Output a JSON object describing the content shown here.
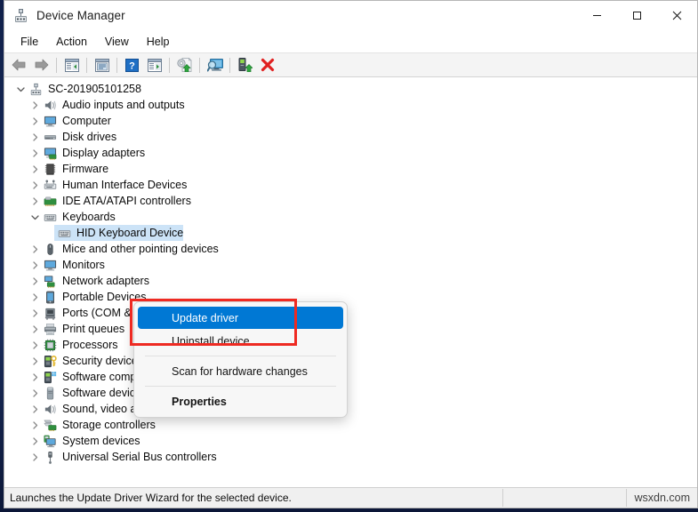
{
  "window": {
    "title": "Device Manager",
    "icon": "device-manager-icon",
    "controls": {
      "minimize": "minimize-icon",
      "maximize": "maximize-icon",
      "close": "close-icon"
    }
  },
  "menubar": {
    "items": [
      {
        "label": "File"
      },
      {
        "label": "Action"
      },
      {
        "label": "View"
      },
      {
        "label": "Help"
      }
    ]
  },
  "toolbar": {
    "buttons": [
      {
        "name": "back-icon",
        "title": "Back"
      },
      {
        "name": "forward-icon",
        "title": "Forward"
      },
      {
        "name": "show-hide-console-tree-icon",
        "title": "Show/Hide Console Tree"
      },
      {
        "name": "properties-icon",
        "title": "Properties"
      },
      {
        "name": "help-icon",
        "title": "Help"
      },
      {
        "name": "view-details-icon",
        "title": "View"
      },
      {
        "name": "update-driver-icon",
        "title": "Update driver"
      },
      {
        "name": "scan-for-hardware-changes-icon",
        "title": "Scan for hardware changes"
      },
      {
        "name": "enable-device-icon",
        "title": "Enable device"
      },
      {
        "name": "uninstall-device-icon",
        "title": "Uninstall device"
      }
    ]
  },
  "tree": {
    "root": {
      "label": "SC-201905101258",
      "icon": "computer-root-icon",
      "expanded": true
    },
    "items": [
      {
        "label": "Audio inputs and outputs",
        "icon": "speaker-icon",
        "indent": 1,
        "expandable": true,
        "expanded": false
      },
      {
        "label": "Computer",
        "icon": "monitor-icon",
        "indent": 1,
        "expandable": true,
        "expanded": false
      },
      {
        "label": "Disk drives",
        "icon": "disk-drive-icon",
        "indent": 1,
        "expandable": true,
        "expanded": false
      },
      {
        "label": "Display adapters",
        "icon": "display-adapter-icon",
        "indent": 1,
        "expandable": true,
        "expanded": false
      },
      {
        "label": "Firmware",
        "icon": "firmware-icon",
        "indent": 1,
        "expandable": true,
        "expanded": false
      },
      {
        "label": "Human Interface Devices",
        "icon": "hid-icon",
        "indent": 1,
        "expandable": true,
        "expanded": false
      },
      {
        "label": "IDE ATA/ATAPI controllers",
        "icon": "ide-controller-icon",
        "indent": 1,
        "expandable": true,
        "expanded": false
      },
      {
        "label": "Keyboards",
        "icon": "keyboard-icon",
        "indent": 1,
        "expandable": true,
        "expanded": true
      },
      {
        "label": "HID Keyboard Device",
        "icon": "keyboard-icon",
        "indent": 2,
        "expandable": false,
        "expanded": false,
        "selected": true
      },
      {
        "label": "Mice and other pointing devices",
        "icon": "mouse-icon",
        "indent": 1,
        "expandable": true,
        "expanded": false
      },
      {
        "label": "Monitors",
        "icon": "monitor-icon",
        "indent": 1,
        "expandable": true,
        "expanded": false
      },
      {
        "label": "Network adapters",
        "icon": "network-adapter-icon",
        "indent": 1,
        "expandable": true,
        "expanded": false
      },
      {
        "label": "Portable Devices",
        "icon": "portable-device-icon",
        "indent": 1,
        "expandable": true,
        "expanded": false
      },
      {
        "label": "Ports (COM & LPT)",
        "icon": "ports-icon",
        "indent": 1,
        "expandable": true,
        "expanded": false
      },
      {
        "label": "Print queues",
        "icon": "printer-icon",
        "indent": 1,
        "expandable": true,
        "expanded": false
      },
      {
        "label": "Processors",
        "icon": "processor-icon",
        "indent": 1,
        "expandable": true,
        "expanded": false
      },
      {
        "label": "Security devices",
        "icon": "security-device-icon",
        "indent": 1,
        "expandable": true,
        "expanded": false
      },
      {
        "label": "Software components",
        "icon": "software-component-icon",
        "indent": 1,
        "expandable": true,
        "expanded": false
      },
      {
        "label": "Software devices",
        "icon": "software-device-icon",
        "indent": 1,
        "expandable": true,
        "expanded": false
      },
      {
        "label": "Sound, video and game controllers",
        "icon": "speaker-icon",
        "indent": 1,
        "expandable": true,
        "expanded": false
      },
      {
        "label": "Storage controllers",
        "icon": "storage-controller-icon",
        "indent": 1,
        "expandable": true,
        "expanded": false
      },
      {
        "label": "System devices",
        "icon": "system-device-icon",
        "indent": 1,
        "expandable": true,
        "expanded": false
      },
      {
        "label": "Universal Serial Bus controllers",
        "icon": "usb-icon",
        "indent": 1,
        "expandable": true,
        "expanded": false
      }
    ]
  },
  "context_menu": {
    "items": [
      {
        "label": "Update driver",
        "highlighted": true,
        "bold": false
      },
      {
        "label": "Uninstall device",
        "highlighted": false,
        "bold": false
      },
      {
        "separator": true
      },
      {
        "label": "Scan for hardware changes",
        "highlighted": false,
        "bold": false
      },
      {
        "separator": true
      },
      {
        "label": "Properties",
        "highlighted": false,
        "bold": true
      }
    ]
  },
  "statusbar": {
    "message": "Launches the Update Driver Wizard for the selected device.",
    "middle": "",
    "watermark": "wsxdn.com"
  },
  "colors": {
    "accent": "#0078d4",
    "highlight_box": "#ee2a22",
    "selection": "#cce3f7",
    "desktop": "#1b2a52"
  }
}
